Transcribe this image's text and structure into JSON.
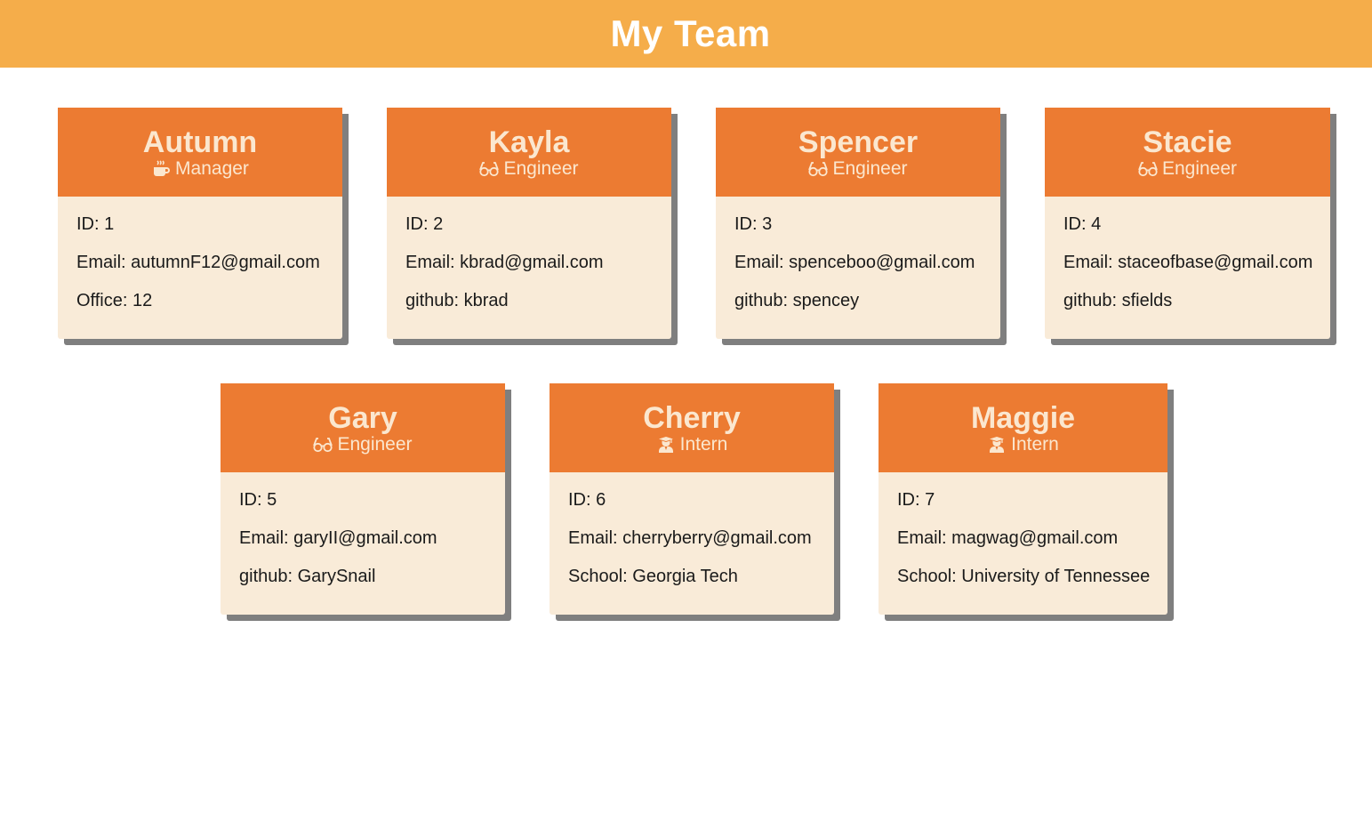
{
  "header": {
    "title": "My Team"
  },
  "colors": {
    "header_bg": "#f5ad4a",
    "card_head_bg": "#ec7b32",
    "card_body_bg": "#f9ebd8",
    "card_title_text": "#fbe7cf",
    "card_shadow": "#7f7f7f"
  },
  "employees": [
    {
      "name": "Autumn",
      "role": "Manager",
      "icon": "coffee-mug-icon",
      "id_line": "ID: 1",
      "email_line": "Email: autumnF12@gmail.com",
      "extra_line": "Office: 12"
    },
    {
      "name": "Kayla",
      "role": "Engineer",
      "icon": "glasses-icon",
      "id_line": "ID: 2",
      "email_line": "Email: kbrad@gmail.com",
      "extra_line": "github: kbrad"
    },
    {
      "name": "Spencer",
      "role": "Engineer",
      "icon": "glasses-icon",
      "id_line": "ID: 3",
      "email_line": "Email: spenceboo@gmail.com",
      "extra_line": "github: spencey"
    },
    {
      "name": "Stacie",
      "role": "Engineer",
      "icon": "glasses-icon",
      "id_line": "ID: 4",
      "email_line": "Email: staceofbase@gmail.com",
      "extra_line": "github: sfields"
    },
    {
      "name": "Gary",
      "role": "Engineer",
      "icon": "glasses-icon",
      "id_line": "ID: 5",
      "email_line": "Email: garyII@gmail.com",
      "extra_line": "github: GarySnail"
    },
    {
      "name": "Cherry",
      "role": "Intern",
      "icon": "graduate-icon",
      "id_line": "ID: 6",
      "email_line": "Email: cherryberry@gmail.com",
      "extra_line": "School: Georgia Tech"
    },
    {
      "name": "Maggie",
      "role": "Intern",
      "icon": "graduate-icon",
      "id_line": "ID: 7",
      "email_line": "Email: magwag@gmail.com",
      "extra_line": "School: University of Tennessee"
    }
  ]
}
